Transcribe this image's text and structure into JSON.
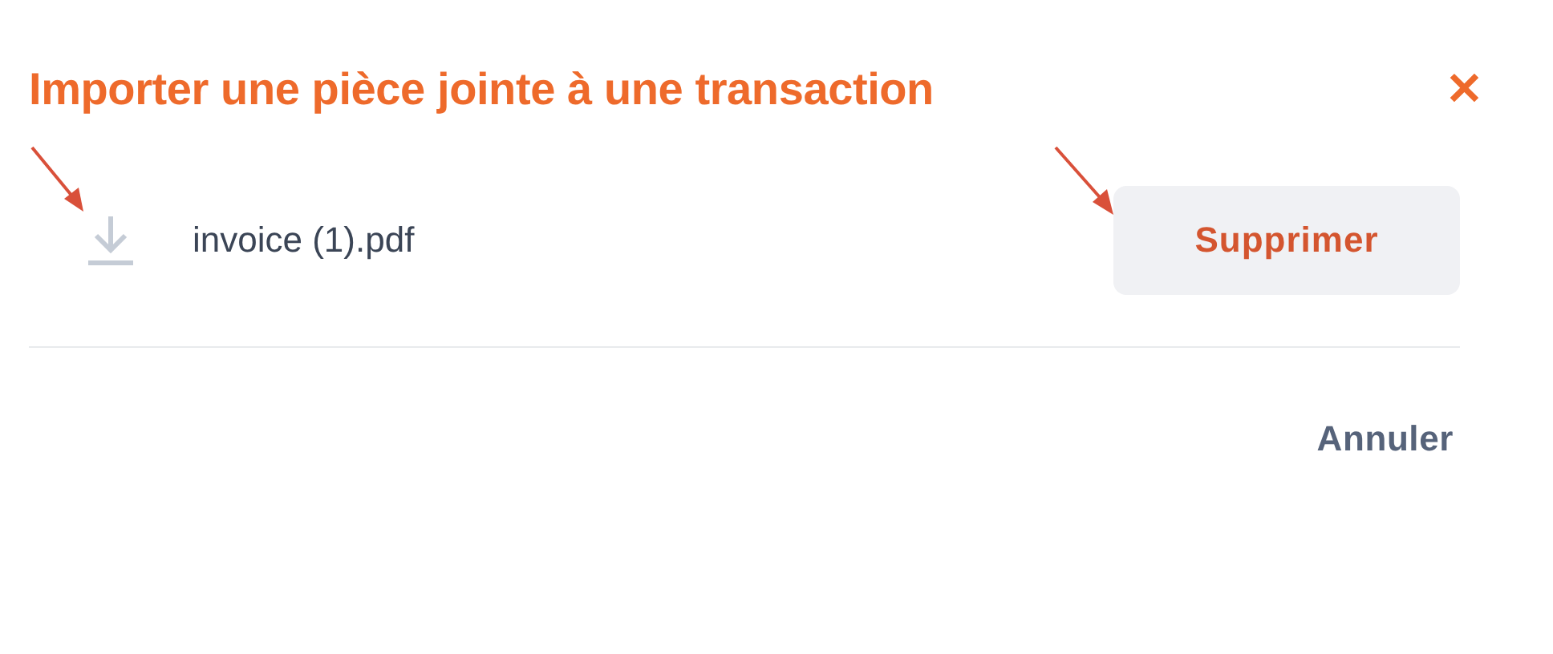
{
  "dialog": {
    "title": "Importer une pièce jointe à une transaction",
    "close": "✕"
  },
  "attachment": {
    "file_name": "invoice (1).pdf",
    "remove_button": "Supprimer"
  },
  "footer": {
    "buttons": [
      "Annuler"
    ]
  }
}
